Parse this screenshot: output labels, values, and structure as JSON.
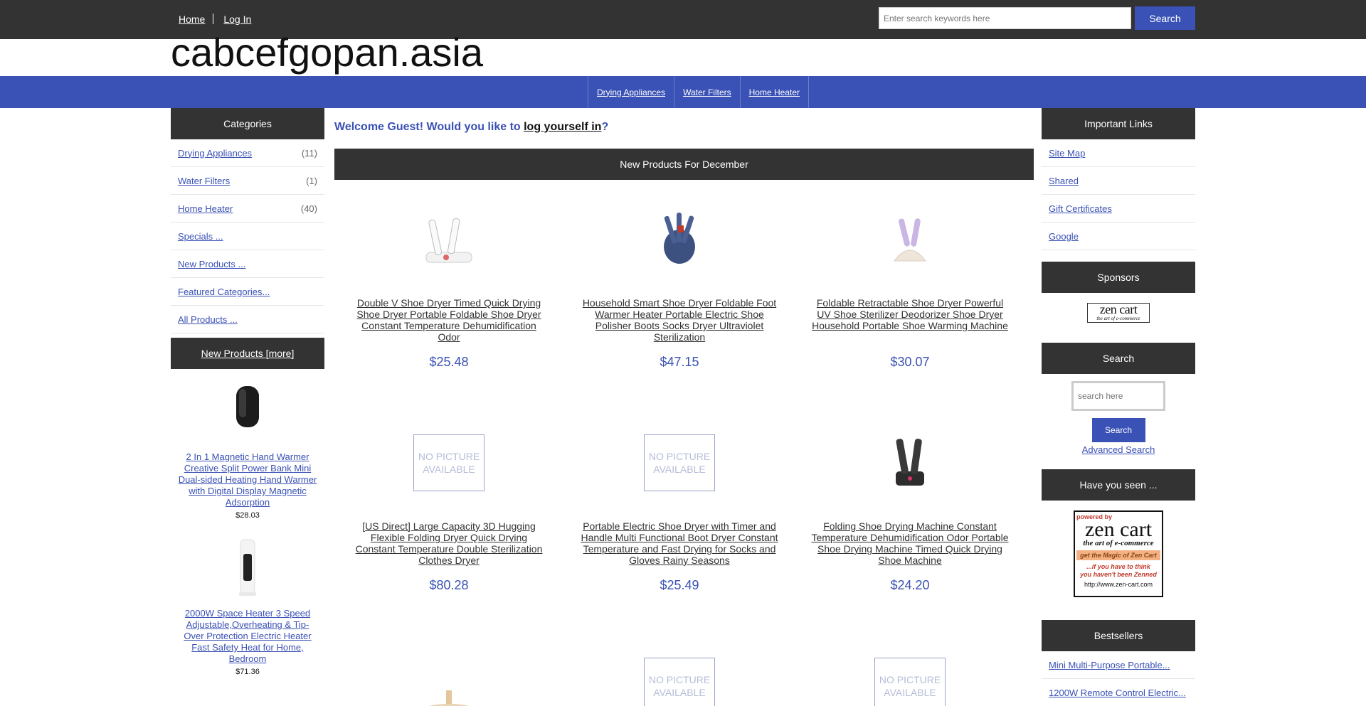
{
  "topnav": {
    "home": "Home",
    "login": "Log In"
  },
  "top_search": {
    "placeholder": "Enter search keywords here",
    "button": "Search"
  },
  "site": {
    "logo": "cabcefgopan.asia"
  },
  "catnav": [
    "Drying Appliances",
    "Water Filters",
    "Home Heater"
  ],
  "categories": {
    "title": "Categories",
    "items": [
      {
        "label": "Drying Appliances",
        "count": "(11)"
      },
      {
        "label": "Water Filters",
        "count": "(1)"
      },
      {
        "label": "Home Heater",
        "count": "(40)"
      },
      {
        "label": "Specials ...",
        "count": ""
      },
      {
        "label": "New Products ...",
        "count": ""
      },
      {
        "label": "Featured Categories...",
        "count": ""
      },
      {
        "label": "All Products ...",
        "count": ""
      }
    ]
  },
  "new_products_box": {
    "title": "New Products  [more]",
    "items": [
      {
        "name": "2 In 1 Magnetic Hand Warmer Creative Split Power Bank Mini Dual-sided Heating Hand Warmer with Digital Display Magnetic Adsorption",
        "price": "$28.03"
      },
      {
        "name": "2000W Space Heater 3 Speed Adjustable,Overheating & Tip-Over Protection Electric Heater Fast Safety Heat for Home, Bedroom",
        "price": "$71.36"
      }
    ]
  },
  "welcome": {
    "prefix": "Welcome Guest! Would you like to ",
    "link": "log yourself in",
    "suffix": "?"
  },
  "main": {
    "section_title": "New Products For December",
    "nopic_text": "NO PICTURE AVAILABLE",
    "products": [
      {
        "name": "Double V Shoe Dryer Timed Quick Drying Shoe Dryer Portable Foldable Shoe Dryer Constant Temperature Dehumidification Odor",
        "price": "$25.48",
        "image": "shoe-dryer-white-photo"
      },
      {
        "name": "Household Smart Shoe Dryer Foldable Foot Warmer Heater Portable Electric Shoe Polisher Boots Socks Dryer Ultraviolet Sterilization",
        "price": "$47.15",
        "image": "shoe-dryer-blue-photo"
      },
      {
        "name": "Foldable Retractable Shoe Dryer Powerful UV Shoe Sterilizer Deodorizer Shoe Dryer Household Portable Shoe Warming Machine",
        "price": "$30.07",
        "image": "shoe-dryer-purple-photo"
      },
      {
        "name": "[US Direct] Large Capacity 3D Hugging Flexible Folding Dryer Quick Drying Constant Temperature Double Sterilization Clothes Dryer",
        "price": "$80.28",
        "image": "no-picture"
      },
      {
        "name": "Portable Electric Shoe Dryer with Timer and Handle Multi Functional Boot Dryer Constant Temperature and Fast Drying for Socks and Gloves Rainy Seasons",
        "price": "$25.49",
        "image": "no-picture"
      },
      {
        "name": "Folding Shoe Drying Machine Constant Temperature Dehumidification Odor Portable Shoe Drying Machine Timed Quick Drying Shoe Machine",
        "price": "$24.20",
        "image": "shoe-dryer-dark-photo"
      }
    ]
  },
  "important_links": {
    "title": "Important Links",
    "items": [
      "Site Map",
      "Shared",
      "Gift Certificates",
      "Google"
    ]
  },
  "sponsors": {
    "title": "Sponsors",
    "logo_main": "zen cart",
    "logo_sub": "the art of e-commerce"
  },
  "side_search": {
    "title": "Search",
    "placeholder": "search here",
    "button": "Search",
    "advanced": "Advanced Search"
  },
  "have_you_seen": {
    "title": "Have you seen ...",
    "powered": "powered by",
    "zen": "zen cart",
    "art": "the art of e-commerce",
    "magic": "get the Magic of Zen Cart",
    "think1": "...if you have to think",
    "think2": "you haven't been Zenned",
    "url": "http://www.zen-cart.com"
  },
  "bestsellers": {
    "title": "Bestsellers",
    "items": [
      "Mini Multi-Purpose Portable...",
      "1200W Remote Control Electric..."
    ]
  },
  "colors": {
    "dark": "#333333",
    "accent": "#3a51b5"
  }
}
